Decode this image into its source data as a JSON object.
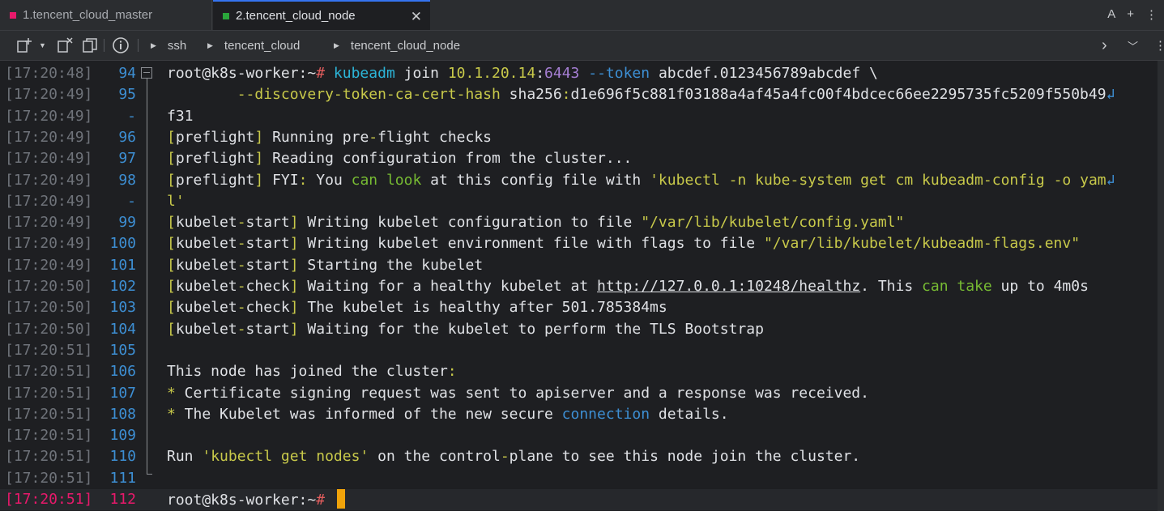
{
  "tabs": [
    {
      "label": "1.tencent_cloud_master",
      "color": "#e8196b"
    },
    {
      "label": "2.tencent_cloud_node",
      "color": "#2aa63b"
    }
  ],
  "tabbar_right": {
    "font_label": "A",
    "add_label": "+"
  },
  "breadcrumb": [
    "ssh",
    "tencent_cloud",
    "tencent_cloud_node"
  ],
  "colors": {
    "green": "#77bb33",
    "yellow": "#c8c94a",
    "blue": "#3d8fd4",
    "cyan": "#2cb5d8",
    "purple": "#a67fd4",
    "red": "#e05c5c",
    "white": "#dfe1e5",
    "pink": "#e8196b",
    "cursor": "#f0a30a"
  },
  "lines": [
    {
      "ts": "[17:20:48]",
      "ln": "94",
      "segs": [
        [
          "root@k8s-worker:~",
          "white"
        ],
        [
          "# ",
          "red"
        ],
        [
          "kubeadm",
          "cyan"
        ],
        [
          " join ",
          "white"
        ],
        [
          "10.1.20.14",
          "yellow"
        ],
        [
          ":",
          "white"
        ],
        [
          "6443",
          "purple"
        ],
        [
          " --token ",
          "blue"
        ],
        [
          "abcdef.0123456789abcdef \\",
          "white"
        ]
      ]
    },
    {
      "ts": "[17:20:49]",
      "ln": "95",
      "segs": [
        [
          "        --discovery-token-ca-cert-hash ",
          "yellow"
        ],
        [
          "sha256",
          "white"
        ],
        [
          ":",
          "yellow"
        ],
        [
          "d1e696f5c881f03188a4af45a4fc00f4bdcec66ee2295735fc5209f550b49",
          "white"
        ]
      ],
      "wrap": true
    },
    {
      "ts": "[17:20:49]",
      "ln": "-",
      "segs": [
        [
          "f31",
          "white"
        ]
      ]
    },
    {
      "ts": "[17:20:49]",
      "ln": "96",
      "segs": [
        [
          "[",
          "yellow"
        ],
        [
          "preflight",
          "white"
        ],
        [
          "]",
          "yellow"
        ],
        [
          " Running pre",
          "white"
        ],
        [
          "-",
          "yellow"
        ],
        [
          "flight checks",
          "white"
        ]
      ]
    },
    {
      "ts": "[17:20:49]",
      "ln": "97",
      "segs": [
        [
          "[",
          "yellow"
        ],
        [
          "preflight",
          "white"
        ],
        [
          "]",
          "yellow"
        ],
        [
          " Reading configuration from the cluster...",
          "white"
        ]
      ]
    },
    {
      "ts": "[17:20:49]",
      "ln": "98",
      "segs": [
        [
          "[",
          "yellow"
        ],
        [
          "preflight",
          "white"
        ],
        [
          "]",
          "yellow"
        ],
        [
          " FYI",
          "white"
        ],
        [
          ":",
          "yellow"
        ],
        [
          " You ",
          "white"
        ],
        [
          "can look",
          "green"
        ],
        [
          " at this config file with ",
          "white"
        ],
        [
          "'kubectl -n kube-system get cm kubeadm-config -o yam",
          "yellow"
        ]
      ],
      "wrap": true
    },
    {
      "ts": "[17:20:49]",
      "ln": "-",
      "segs": [
        [
          "l'",
          "yellow"
        ]
      ]
    },
    {
      "ts": "[17:20:49]",
      "ln": "99",
      "segs": [
        [
          "[",
          "yellow"
        ],
        [
          "kubelet",
          "white"
        ],
        [
          "-",
          "yellow"
        ],
        [
          "start",
          "white"
        ],
        [
          "]",
          "yellow"
        ],
        [
          " Writing kubelet configuration to file ",
          "white"
        ],
        [
          "\"/var/lib/kubelet/config.yaml\"",
          "yellow"
        ]
      ]
    },
    {
      "ts": "[17:20:49]",
      "ln": "100",
      "segs": [
        [
          "[",
          "yellow"
        ],
        [
          "kubelet",
          "white"
        ],
        [
          "-",
          "yellow"
        ],
        [
          "start",
          "white"
        ],
        [
          "]",
          "yellow"
        ],
        [
          " Writing kubelet environment file with flags to file ",
          "white"
        ],
        [
          "\"/var/lib/kubelet/kubeadm-flags.env\"",
          "yellow"
        ]
      ]
    },
    {
      "ts": "[17:20:49]",
      "ln": "101",
      "segs": [
        [
          "[",
          "yellow"
        ],
        [
          "kubelet",
          "white"
        ],
        [
          "-",
          "yellow"
        ],
        [
          "start",
          "white"
        ],
        [
          "]",
          "yellow"
        ],
        [
          " Starting the kubelet",
          "white"
        ]
      ]
    },
    {
      "ts": "[17:20:50]",
      "ln": "102",
      "segs": [
        [
          "[",
          "yellow"
        ],
        [
          "kubelet",
          "white"
        ],
        [
          "-",
          "yellow"
        ],
        [
          "check",
          "white"
        ],
        [
          "]",
          "yellow"
        ],
        [
          " Waiting for a healthy kubelet at ",
          "white"
        ],
        [
          "http://127.0.0.1:10248/healthz",
          "link"
        ],
        [
          ". This ",
          "white"
        ],
        [
          "can take",
          "green"
        ],
        [
          " up to 4m0s",
          "white"
        ]
      ]
    },
    {
      "ts": "[17:20:50]",
      "ln": "103",
      "segs": [
        [
          "[",
          "yellow"
        ],
        [
          "kubelet",
          "white"
        ],
        [
          "-",
          "yellow"
        ],
        [
          "check",
          "white"
        ],
        [
          "]",
          "yellow"
        ],
        [
          " The kubelet is healthy after 501.785384ms",
          "white"
        ]
      ]
    },
    {
      "ts": "[17:20:50]",
      "ln": "104",
      "segs": [
        [
          "[",
          "yellow"
        ],
        [
          "kubelet",
          "white"
        ],
        [
          "-",
          "yellow"
        ],
        [
          "start",
          "white"
        ],
        [
          "]",
          "yellow"
        ],
        [
          " Waiting for the kubelet to perform the TLS Bootstrap",
          "white"
        ]
      ]
    },
    {
      "ts": "[17:20:51]",
      "ln": "105",
      "segs": []
    },
    {
      "ts": "[17:20:51]",
      "ln": "106",
      "segs": [
        [
          "This node has joined the cluster",
          "white"
        ],
        [
          ":",
          "yellow"
        ]
      ]
    },
    {
      "ts": "[17:20:51]",
      "ln": "107",
      "segs": [
        [
          "*",
          "yellow"
        ],
        [
          " Certificate signing request was sent to apiserver and a response was received.",
          "white"
        ]
      ]
    },
    {
      "ts": "[17:20:51]",
      "ln": "108",
      "segs": [
        [
          "*",
          "yellow"
        ],
        [
          " The Kubelet was informed of the new secure ",
          "white"
        ],
        [
          "connection",
          "blue"
        ],
        [
          " details.",
          "white"
        ]
      ]
    },
    {
      "ts": "[17:20:51]",
      "ln": "109",
      "segs": []
    },
    {
      "ts": "[17:20:51]",
      "ln": "110",
      "segs": [
        [
          "Run ",
          "white"
        ],
        [
          "'kubectl get nodes'",
          "yellow"
        ],
        [
          " on the control",
          "white"
        ],
        [
          "-",
          "yellow"
        ],
        [
          "plane to see this node join the cluster.",
          "white"
        ]
      ]
    },
    {
      "ts": "[17:20:51]",
      "ln": "111",
      "segs": []
    },
    {
      "ts": "[17:20:51]",
      "ln": "112",
      "segs": [
        [
          "root@k8s-worker:~",
          "white"
        ],
        [
          "# ",
          "red"
        ]
      ],
      "current": true
    }
  ]
}
